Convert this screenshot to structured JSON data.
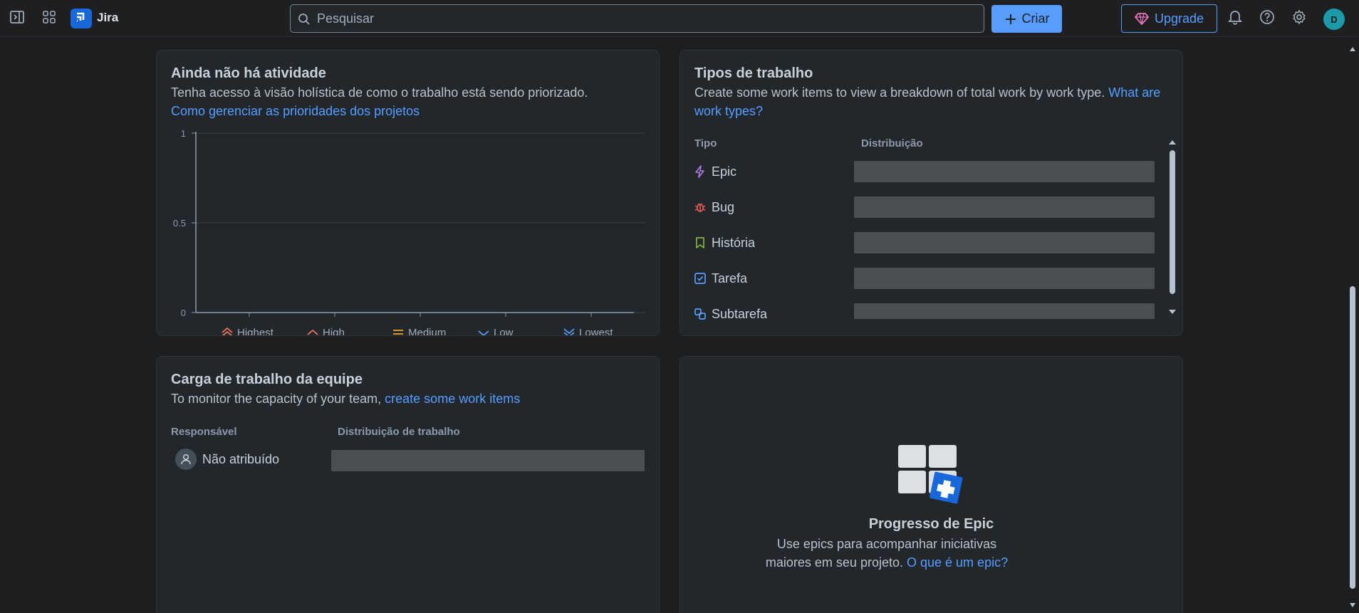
{
  "topbar": {
    "app_name": "Jira",
    "search_placeholder": "Pesquisar",
    "create_label": "Criar",
    "upgrade_label": "Upgrade",
    "avatar_initial": "D",
    "icons": [
      "sidebar-toggle-icon",
      "app-switcher-icon",
      "jira-logo-icon",
      "search-icon",
      "plus-icon",
      "gem-icon",
      "bell-icon",
      "help-icon",
      "gear-icon"
    ]
  },
  "priority_card": {
    "title": "Ainda não há atividade",
    "subtitle": "Tenha acesso à visão holística de como o trabalho está sendo priorizado.",
    "link": "Como gerenciar as prioridades dos projetos"
  },
  "chart_data": {
    "type": "bar",
    "categories": [
      "Highest",
      "High",
      "Medium",
      "Low",
      "Lowest"
    ],
    "values": [
      0,
      0,
      0,
      0,
      0
    ],
    "yticks": [
      "1",
      "0.5",
      "0"
    ],
    "ylim": [
      0,
      1
    ],
    "grid": true,
    "category_colors": [
      "#f87462",
      "#f87462",
      "#f5a623",
      "#579dff",
      "#579dff"
    ]
  },
  "work_types_card": {
    "title": "Tipos de trabalho",
    "subtitle": "Create some work items to view a breakdown of total work by work type.",
    "link": "What are work types?",
    "col_type": "Tipo",
    "col_distribution": "Distribuição",
    "rows": [
      {
        "label": "Epic",
        "icon": "epic-icon",
        "color": "#b47ae4"
      },
      {
        "label": "Bug",
        "icon": "bug-icon",
        "color": "#f15b50"
      },
      {
        "label": "História",
        "icon": "story-icon",
        "color": "#82b536"
      },
      {
        "label": "Tarefa",
        "icon": "task-icon",
        "color": "#579dff"
      },
      {
        "label": "Subtarefa",
        "icon": "subtask-icon",
        "color": "#579dff"
      }
    ]
  },
  "workload_card": {
    "title": "Carga de trabalho da equipe",
    "subtitle": "To monitor the capacity of your team,",
    "link": "create some work items",
    "col_assignee": "Responsável",
    "col_distribution": "Distribuição de trabalho",
    "assignee": "Não atribuído"
  },
  "epic_card": {
    "title": "Progresso de Epic",
    "description": "Use epics para acompanhar iniciativas maiores em seu projeto.",
    "link": "O que é um epic?"
  }
}
